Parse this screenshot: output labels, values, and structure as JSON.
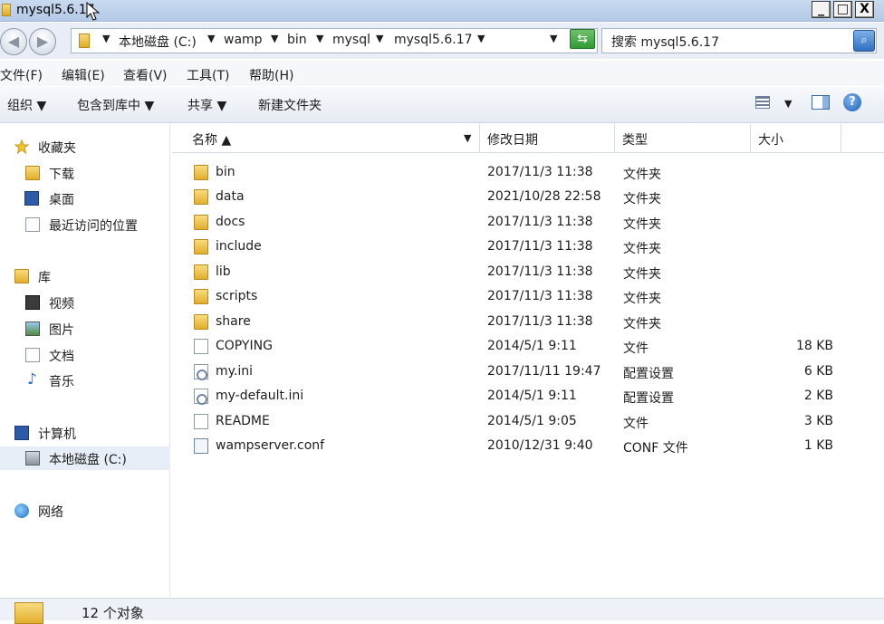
{
  "window": {
    "title": "mysql5.6.17",
    "minimize": "_",
    "maximize": "□",
    "close": "X"
  },
  "address": {
    "crumbs": [
      "本地磁盘 (C:)",
      "wamp",
      "bin",
      "mysql",
      "mysql5.6.17"
    ],
    "search_placeholder": "搜索 mysql5.6.17"
  },
  "menu": [
    "文件(F)",
    "编辑(E)",
    "查看(V)",
    "工具(T)",
    "帮助(H)"
  ],
  "toolbar": {
    "organize": "组织 ▼",
    "include_library": "包含到库中 ▼",
    "share": "共享 ▼",
    "new_folder": "新建文件夹"
  },
  "sidebar": {
    "favorites": "收藏夹",
    "downloads": "下载",
    "desktop": "桌面",
    "recent": "最近访问的位置",
    "libraries": "库",
    "videos": "视频",
    "pictures": "图片",
    "documents": "文档",
    "music": "音乐",
    "computer": "计算机",
    "local_disk": "本地磁盘 (C:)",
    "network": "网络"
  },
  "columns": {
    "name": "名称 ▲",
    "date": "修改日期",
    "type": "类型",
    "size": "大小"
  },
  "files": [
    {
      "name": "bin",
      "date": "2017/11/3 11:38",
      "type": "文件夹",
      "size": "",
      "icon": "folder-icon"
    },
    {
      "name": "data",
      "date": "2021/10/28 22:58",
      "type": "文件夹",
      "size": "",
      "icon": "folder-icon"
    },
    {
      "name": "docs",
      "date": "2017/11/3 11:38",
      "type": "文件夹",
      "size": "",
      "icon": "folder-icon"
    },
    {
      "name": "include",
      "date": "2017/11/3 11:38",
      "type": "文件夹",
      "size": "",
      "icon": "folder-icon"
    },
    {
      "name": "lib",
      "date": "2017/11/3 11:38",
      "type": "文件夹",
      "size": "",
      "icon": "folder-icon"
    },
    {
      "name": "scripts",
      "date": "2017/11/3 11:38",
      "type": "文件夹",
      "size": "",
      "icon": "folder-icon"
    },
    {
      "name": "share",
      "date": "2017/11/3 11:38",
      "type": "文件夹",
      "size": "",
      "icon": "folder-icon"
    },
    {
      "name": "COPYING",
      "date": "2014/5/1 9:11",
      "type": "文件",
      "size": "18 KB",
      "icon": "file-icon"
    },
    {
      "name": "my.ini",
      "date": "2017/11/11 19:47",
      "type": "配置设置",
      "size": "6 KB",
      "icon": "settings-file-icon"
    },
    {
      "name": "my-default.ini",
      "date": "2014/5/1 9:11",
      "type": "配置设置",
      "size": "2 KB",
      "icon": "settings-file-icon"
    },
    {
      "name": "README",
      "date": "2014/5/1 9:05",
      "type": "文件",
      "size": "3 KB",
      "icon": "file-icon"
    },
    {
      "name": "wampserver.conf",
      "date": "2010/12/31 9:40",
      "type": "CONF 文件",
      "size": "1 KB",
      "icon": "conf-file-icon"
    }
  ],
  "status": {
    "count": "12 个对象"
  }
}
